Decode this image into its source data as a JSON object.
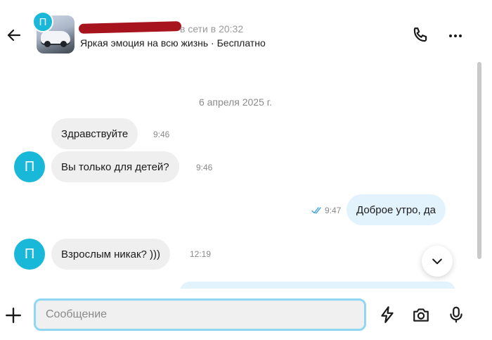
{
  "header": {
    "avatar_letter": "П",
    "online_status": "в сети в 20:32",
    "listing_title": "Яркая эмоция на всю жизнь · Бесплатно",
    "icons": {
      "back": "arrow-left-icon",
      "call": "phone-icon",
      "more": "more-horizontal-icon"
    }
  },
  "chat": {
    "date_separator": "6 апреля 2025 г.",
    "messages": [
      {
        "direction": "incoming",
        "text": "Здравствуйте",
        "time": "9:46",
        "avatar_letter": ""
      },
      {
        "direction": "incoming",
        "text": "Вы только для детей?",
        "time": "9:46",
        "avatar_letter": "П"
      },
      {
        "direction": "outgoing",
        "text": "Доброе утро, да",
        "time": "9:47",
        "read": true
      },
      {
        "direction": "incoming",
        "text": "Взрослым никак? )))",
        "time": "12:19",
        "avatar_letter": "П"
      }
    ],
    "scroll_down_icon": "chevron-down-icon"
  },
  "composer": {
    "placeholder": "Сообщение",
    "value": "",
    "icons": {
      "attach": "plus-icon",
      "quick_replies": "lightning-icon",
      "camera": "camera-icon",
      "voice": "microphone-icon"
    }
  },
  "colors": {
    "accent": "#1ab8d8",
    "outgoing_bubble": "#e3f3fd",
    "incoming_bubble": "#efefef",
    "input_focus_border": "#8fd7f2",
    "read_check": "#3aa0e0"
  }
}
